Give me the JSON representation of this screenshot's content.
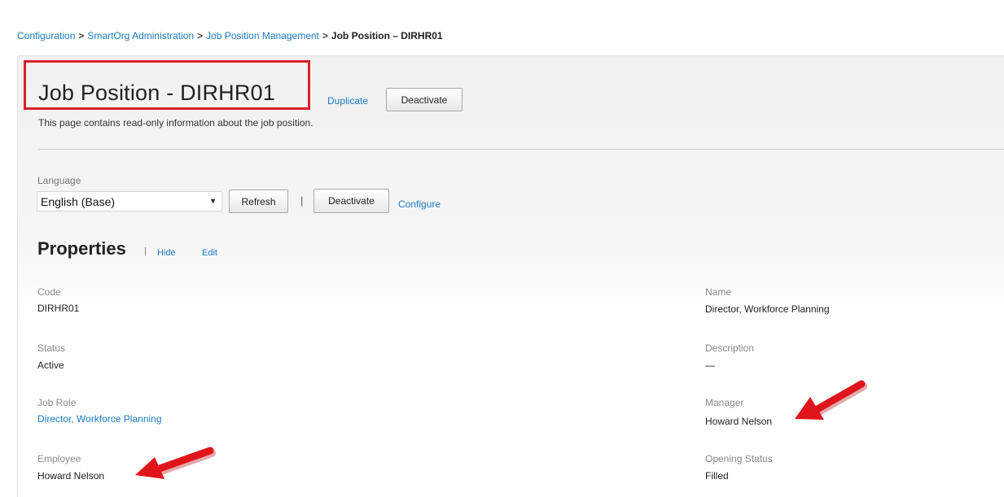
{
  "breadcrumb": {
    "items": [
      "Configuration",
      "SmartOrg Administration",
      "Job Position Management"
    ],
    "separator": ">",
    "current": "Job Position – DIRHR01"
  },
  "page": {
    "title": "Job Position - DIRHR01",
    "description": "This page contains read-only information about the job position.",
    "duplicate_label": "Duplicate",
    "deactivate_label": "Deactivate"
  },
  "language": {
    "label": "Language",
    "selected": "English (Base)",
    "refresh_label": "Refresh",
    "separator": "|",
    "deactivate_label": "Deactivate",
    "configure_label": "Configure"
  },
  "properties": {
    "title": "Properties",
    "separator": "|",
    "hide_label": "Hide",
    "edit_label": "Edit",
    "fields": {
      "code": {
        "label": "Code",
        "value": "DIRHR01"
      },
      "name": {
        "label": "Name",
        "value": "Director, Workforce Planning"
      },
      "status": {
        "label": "Status",
        "value": "Active"
      },
      "description": {
        "label": "Description",
        "value": "—"
      },
      "job_role": {
        "label": "Job Role",
        "value": "Director, Workforce Planning"
      },
      "manager": {
        "label": "Manager",
        "value": "Howard Nelson"
      },
      "employee": {
        "label": "Employee",
        "value": "Howard Nelson"
      },
      "opening_status": {
        "label": "Opening Status",
        "value": "Filled"
      }
    }
  },
  "colors": {
    "link": "#1a7cc4",
    "highlight_box": "#d9202a",
    "annotation_arrow": "#e0141b"
  }
}
